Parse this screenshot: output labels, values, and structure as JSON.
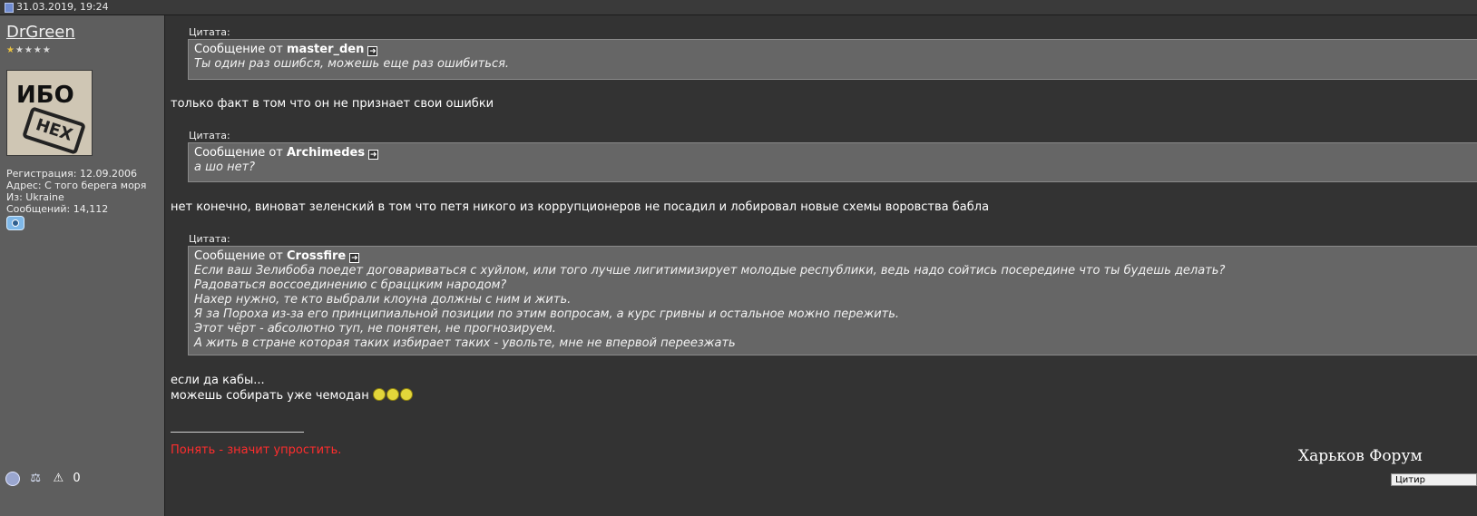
{
  "post": {
    "date": "31.03.2019, 19:24"
  },
  "user": {
    "name": "DrGreen",
    "stars_on": "★",
    "stars_off": "★★★★",
    "avatar_text_top": "ИБО",
    "avatar_text_stamp": "НЕХ",
    "registration": "Регистрация: 12.09.2006",
    "address": "Адрес: С того берега моря",
    "from": "Из: Ukraine",
    "posts": "Сообщений: 14,112",
    "bottom_zero": "0"
  },
  "quote_label": "Цитата:",
  "quote_prefix": "Сообщение от",
  "quotes": [
    {
      "author": "master_den",
      "lines": [
        "Ты один раз ошибся, можешь еще раз ошибиться."
      ]
    },
    {
      "author": "Archimedes",
      "lines": [
        "а шо нет?"
      ]
    },
    {
      "author": "Crossfire",
      "lines": [
        "Если ваш Зелибоба поедет договариваться с хуйлом, или того лучше лигитимизирует молодые республики, ведь надо сойтись посередине что ты будешь делать?",
        "Радоваться воссоединению с браццким народом?",
        "Нахер нужно, те кто выбрали клоуна должны с ним и жить.",
        "Я за Пороха из-за его принципиальной позиции по этим вопросам, а курс гривны и остальное можно пережить.",
        "Этот чёрт - абсолютно туп, не понятен, не прогнозируем.",
        "А жить в стране которая таких избирает таких - увольте, мне не впервой переезжать"
      ]
    }
  ],
  "replies": [
    "только факт в том что он не признает свои ошибки",
    "нет конечно, виноват зеленский в том что петя никого из коррупционеров не посадил и лобировал новые схемы воровства бабла",
    "если да кабы...",
    "можешь собирать уже чемодан"
  ],
  "signature": "Понять - значит упростить.",
  "forum_logo": "Харьков Форум",
  "quote_button": "Цитир",
  "colors": {
    "signature": "#ff2d2d",
    "sidebar_bg": "#5e5e5e",
    "main_bg": "#333333",
    "quote_bg": "#666666"
  },
  "icons": [
    "post-icon",
    "view-post-icon",
    "camera-icon",
    "online-icon",
    "scales-icon",
    "warning-icon",
    "smiley-icon"
  ]
}
